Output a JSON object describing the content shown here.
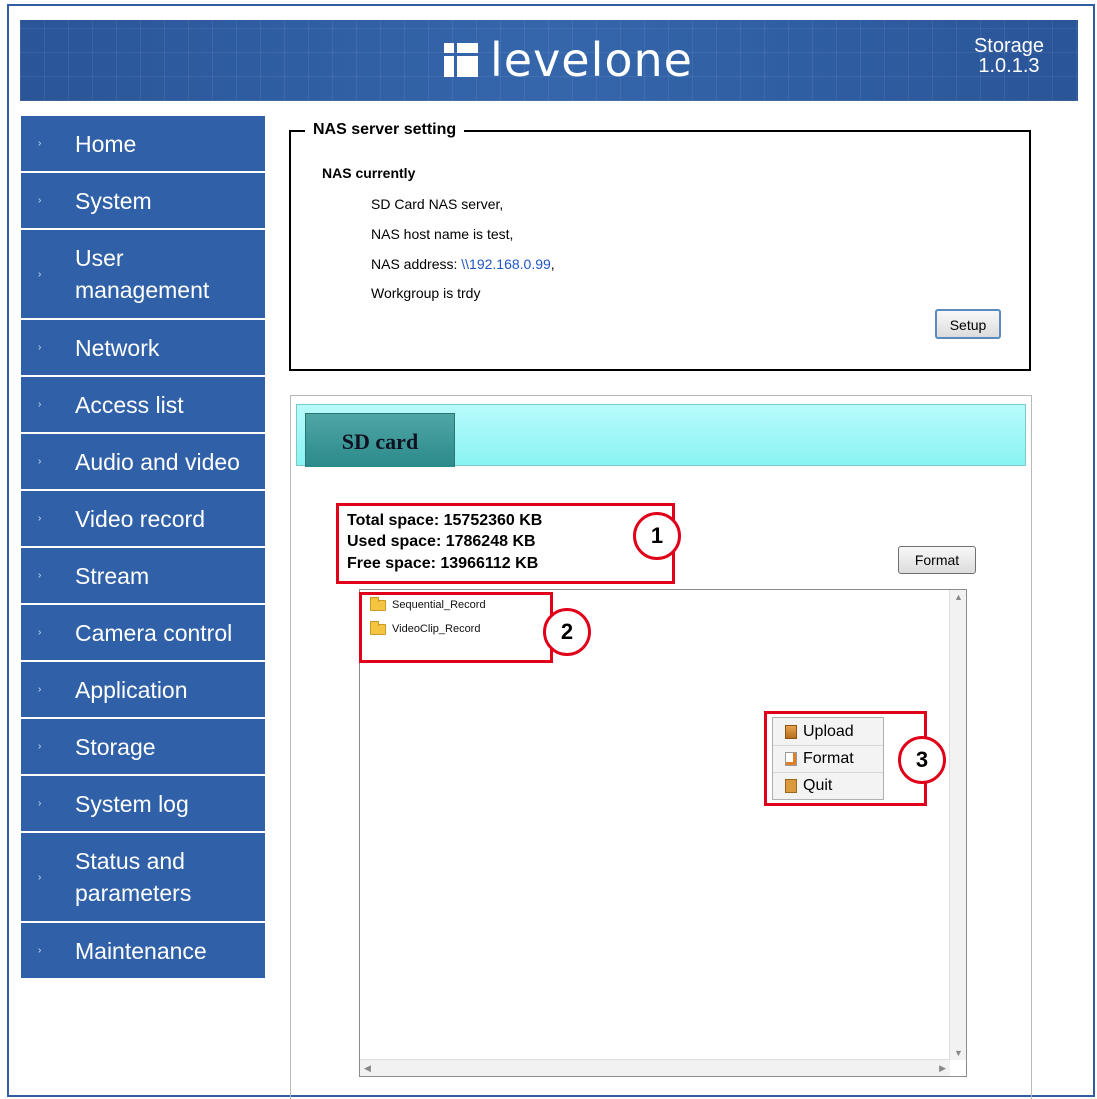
{
  "header": {
    "brand": "levelone",
    "version_label": "Storage",
    "version_number": "1.0.1.3"
  },
  "sidebar": {
    "items": [
      {
        "label": "Home"
      },
      {
        "label": "System"
      },
      {
        "label": "User management"
      },
      {
        "label": "Network"
      },
      {
        "label": "Access list"
      },
      {
        "label": "Audio and video"
      },
      {
        "label": "Video record"
      },
      {
        "label": "Stream"
      },
      {
        "label": "Camera control"
      },
      {
        "label": "Application"
      },
      {
        "label": "Storage"
      },
      {
        "label": "System log"
      },
      {
        "label": "Status and parameters"
      },
      {
        "label": "Maintenance"
      }
    ]
  },
  "nas": {
    "legend": "NAS server setting",
    "title": "NAS currently",
    "line1": "SD Card NAS server,",
    "line2": "NAS host name is test,",
    "address_prefix": "NAS address: ",
    "address": "\\\\192.168.0.99",
    "address_suffix": ",",
    "line4": "Workgroup is trdy",
    "setup_label": "Setup"
  },
  "storage": {
    "tab_label": "SD card",
    "total": "Total space: 15752360 KB",
    "used": "Used space: 1786248 KB",
    "free": "Free space: 13966112 KB",
    "format_label": "Format",
    "files": [
      {
        "name": "Sequential_Record"
      },
      {
        "name": "VideoClip_Record"
      }
    ],
    "context_menu": [
      {
        "label": "Upload",
        "icon": "upload-icon"
      },
      {
        "label": "Format",
        "icon": "format-icon"
      },
      {
        "label": "Quit",
        "icon": "quit-icon"
      }
    ]
  },
  "annotations": [
    "1",
    "2",
    "3"
  ],
  "colors": {
    "nav_bg": "#3061a8",
    "header_bg": "#2f5da3",
    "tab_strip": "#8af3f3",
    "tab": "#2b8a8a",
    "annotation_red": "#e0001a",
    "link": "#1f57c4"
  }
}
